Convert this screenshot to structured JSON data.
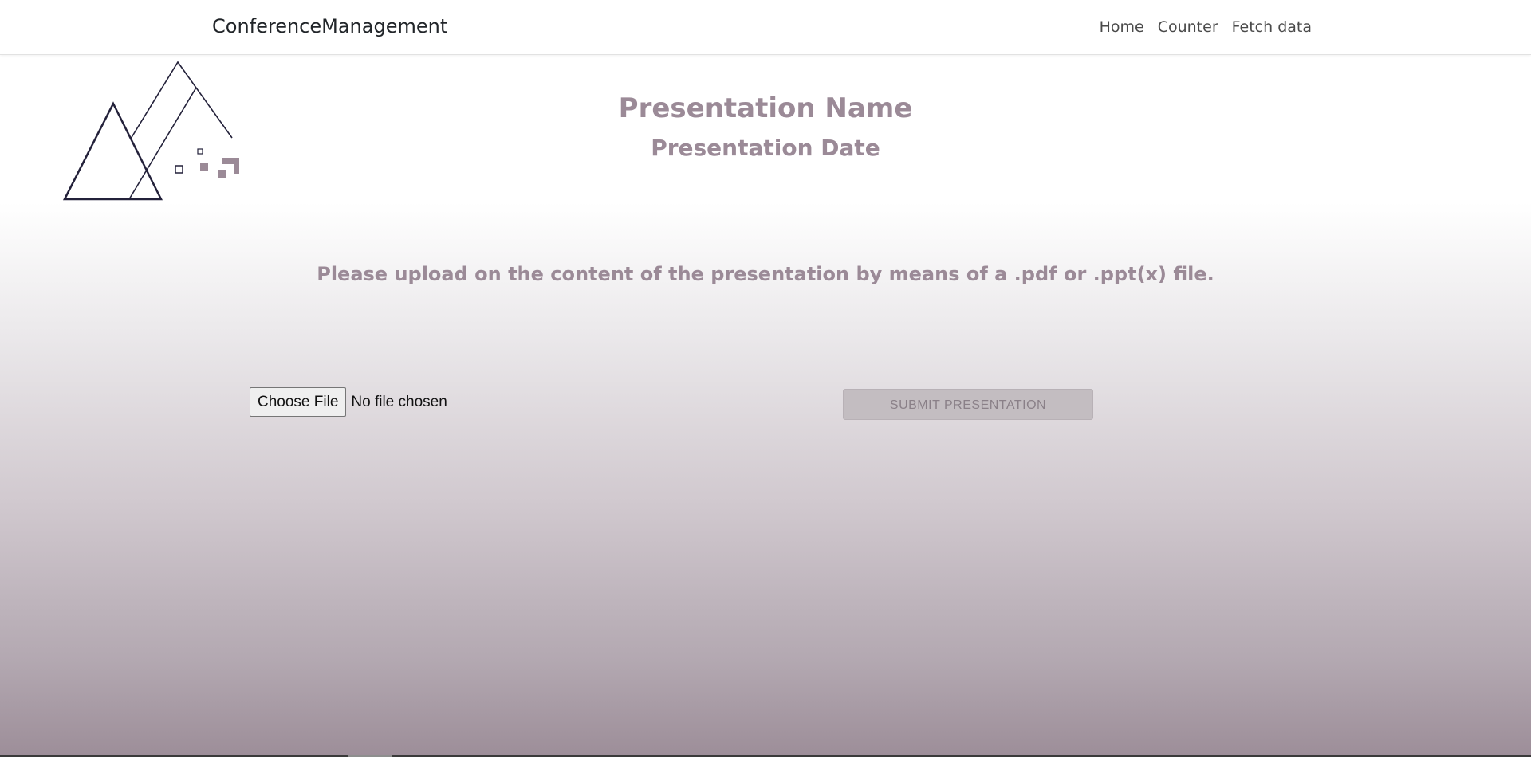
{
  "navbar": {
    "brand": "ConferenceManagement",
    "links": [
      {
        "label": "Home"
      },
      {
        "label": "Counter"
      },
      {
        "label": "Fetch data"
      }
    ]
  },
  "header": {
    "presentation_name": "Presentation Name",
    "presentation_date": "Presentation Date"
  },
  "upload": {
    "instruction": "Please upload on the content of the presentation by means of a .pdf or .ppt(x) file.",
    "choose_file_label": "Choose File",
    "file_status": "No file chosen",
    "submit_label": "SUBMIT PRESENTATION",
    "submit_disabled": true
  },
  "colors": {
    "accent": "#9b8a97",
    "logo_stroke": "#23213a",
    "logo_fill": "#9b8a97"
  }
}
